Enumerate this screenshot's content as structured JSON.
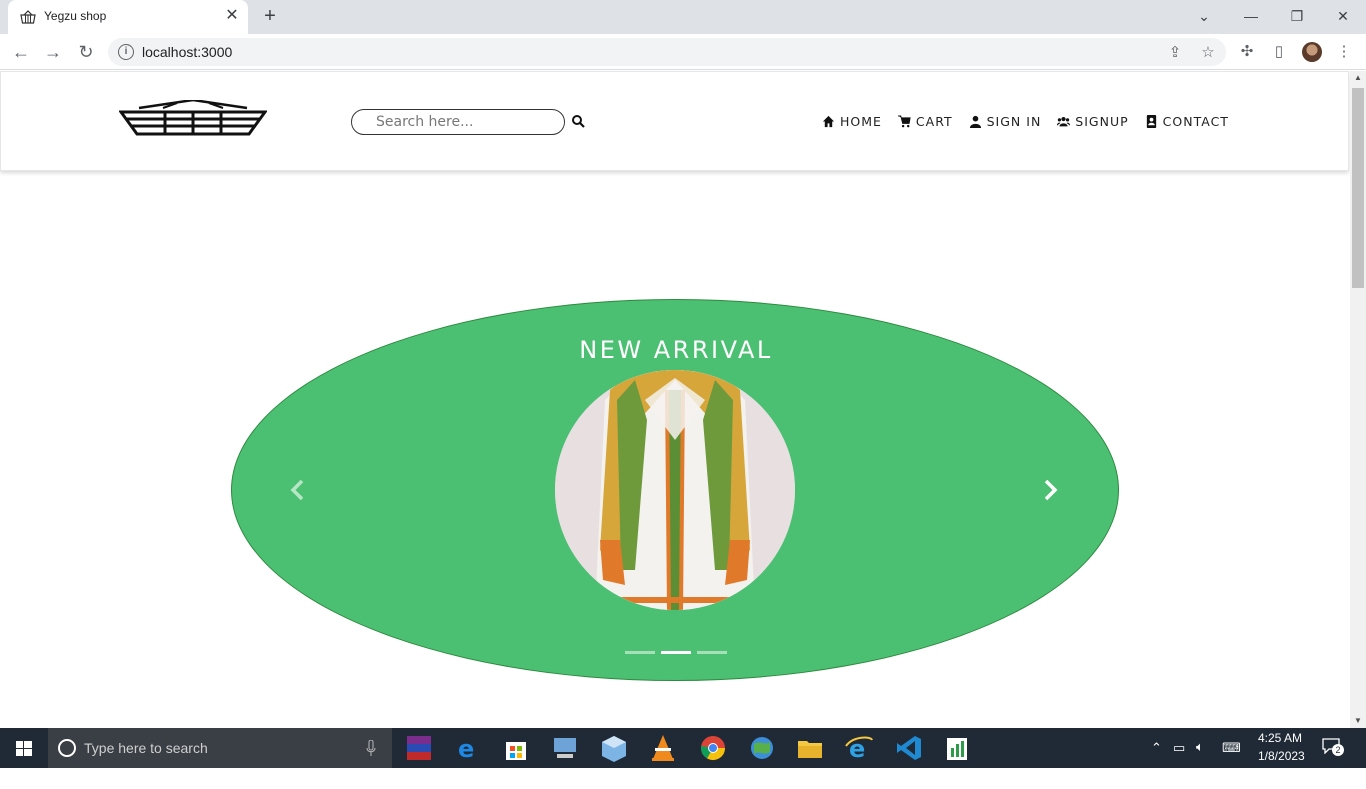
{
  "browser": {
    "tab_title": "Yegzu shop",
    "url": "localhost:3000"
  },
  "site": {
    "search_placeholder": "Search here...",
    "nav": [
      {
        "label": "HOME",
        "icon": "home-icon"
      },
      {
        "label": "CART",
        "icon": "cart-icon"
      },
      {
        "label": "SIGN IN",
        "icon": "user-icon"
      },
      {
        "label": "SIGNUP",
        "icon": "users-icon"
      },
      {
        "label": "CONTACT",
        "icon": "contact-icon"
      }
    ],
    "hero": {
      "title": "NEW ARRIVAL",
      "accent": "#4cc072",
      "active_slide": 2,
      "slide_count": 3
    }
  },
  "taskbar": {
    "search_placeholder": "Type here to search",
    "time": "4:25 AM",
    "date": "1/8/2023",
    "notifications": "2"
  }
}
